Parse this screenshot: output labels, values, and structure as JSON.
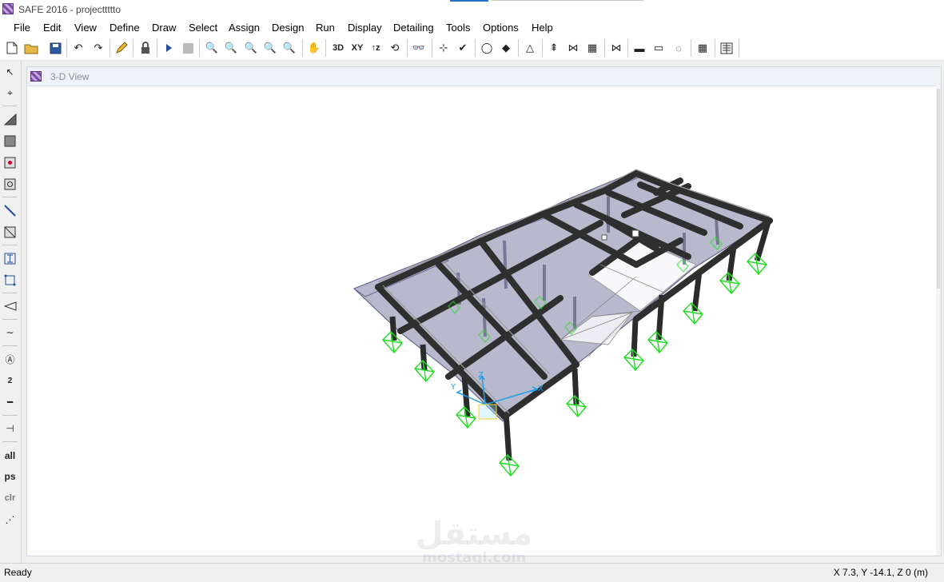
{
  "window": {
    "title": "SAFE 2016 - projecttttto",
    "app_icon": "safe-app-icon"
  },
  "menu": [
    "File",
    "Edit",
    "View",
    "Define",
    "Draw",
    "Select",
    "Assign",
    "Design",
    "Run",
    "Display",
    "Detailing",
    "Tools",
    "Options",
    "Help"
  ],
  "toolbar": {
    "view_3d": "3D",
    "view_xy": "XY",
    "view_up": "↑z"
  },
  "left_toolbar": {
    "all": "all",
    "ps": "ps",
    "clr": "clr",
    "dim": "2"
  },
  "view_window": {
    "title": "3-D View"
  },
  "model_axes": {
    "x": "X",
    "y": "Y",
    "z": "Z"
  },
  "status": {
    "ready": "Ready",
    "coords": "X 7.3,  Y -14.1,  Z 0  (m)"
  },
  "watermark": {
    "arabic": "مستقل",
    "latin": "mostaql.com"
  },
  "colors": {
    "accent": "#1f72c4",
    "support": "#22dd22",
    "beam": "#2f2f2f",
    "slab": "#8f8fb0"
  }
}
